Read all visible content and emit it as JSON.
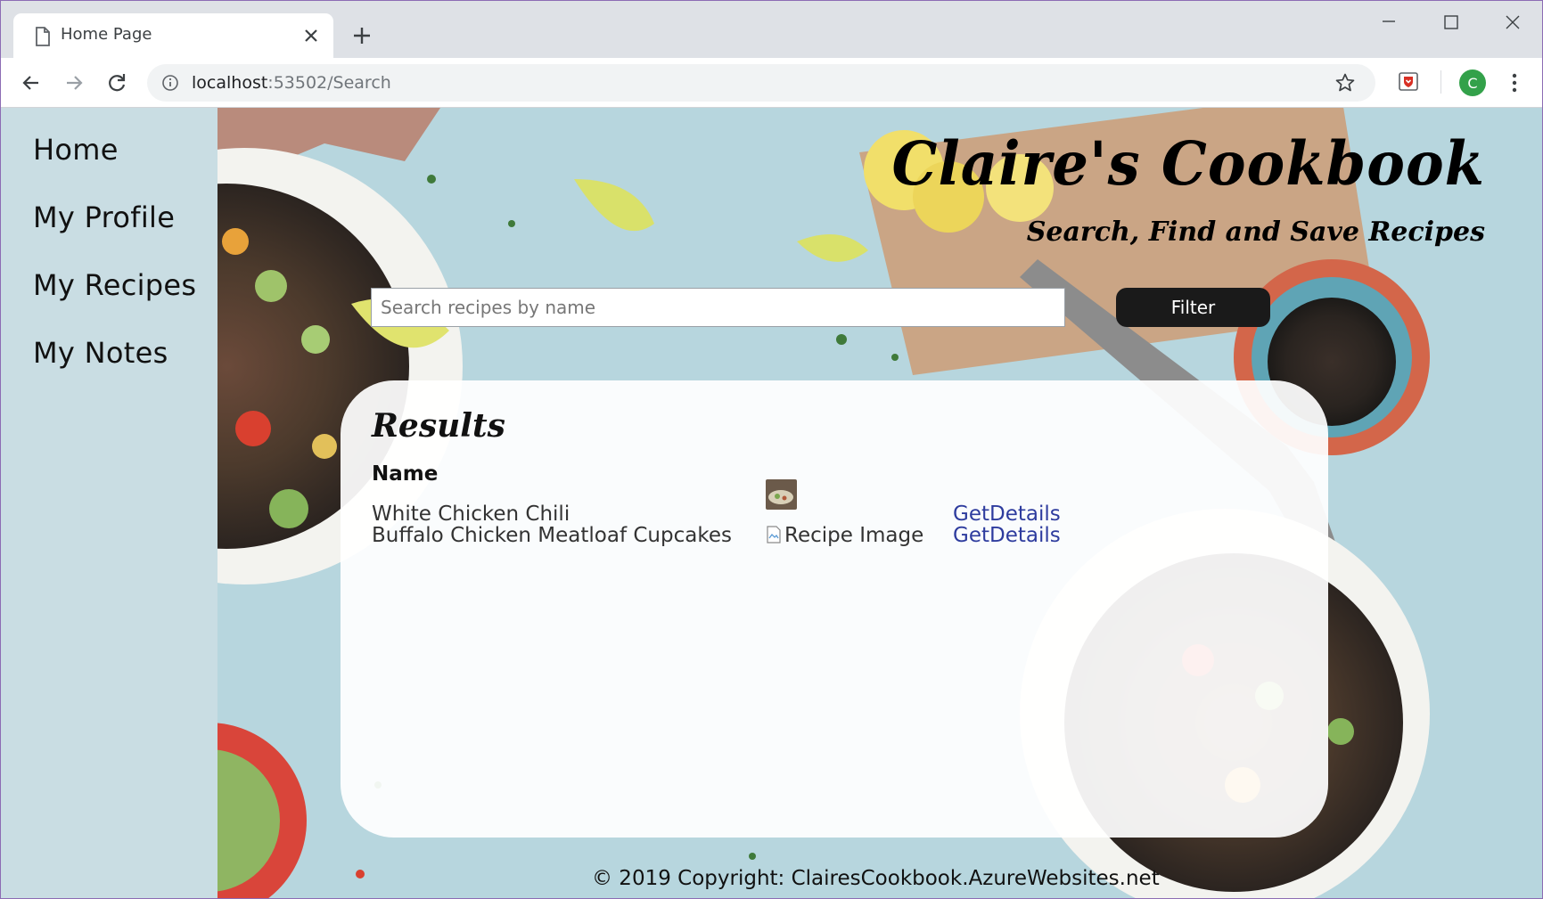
{
  "browser": {
    "tab_title": "Home Page",
    "url_host": "localhost",
    "url_path": ":53502/Search",
    "profile_initial": "C"
  },
  "sidebar": {
    "items": [
      {
        "label": "Home"
      },
      {
        "label": "My Profile"
      },
      {
        "label": "My Recipes"
      },
      {
        "label": "My Notes"
      }
    ]
  },
  "header": {
    "title": "Claire's Cookbook",
    "subtitle": "Search, Find and Save Recipes"
  },
  "search": {
    "placeholder": "Search recipes by name",
    "value": "",
    "button_label": "Filter"
  },
  "results": {
    "heading": "Results",
    "column_name": "Name",
    "rows": [
      {
        "name": "White Chicken Chili",
        "image_alt": "",
        "link": "GetDetails"
      },
      {
        "name": "Buffalo Chicken Meatloaf Cupcakes",
        "image_alt": "Recipe Image",
        "link": "GetDetails"
      }
    ]
  },
  "footer": {
    "text": "© 2019 Copyright: ClairesCookbook.AzureWebsites.net"
  },
  "colors": {
    "sidebar_bg": "#c9dde3",
    "link": "#2e3c9e",
    "button_bg": "#1a1a1a",
    "avatar_bg": "#33a14a"
  }
}
